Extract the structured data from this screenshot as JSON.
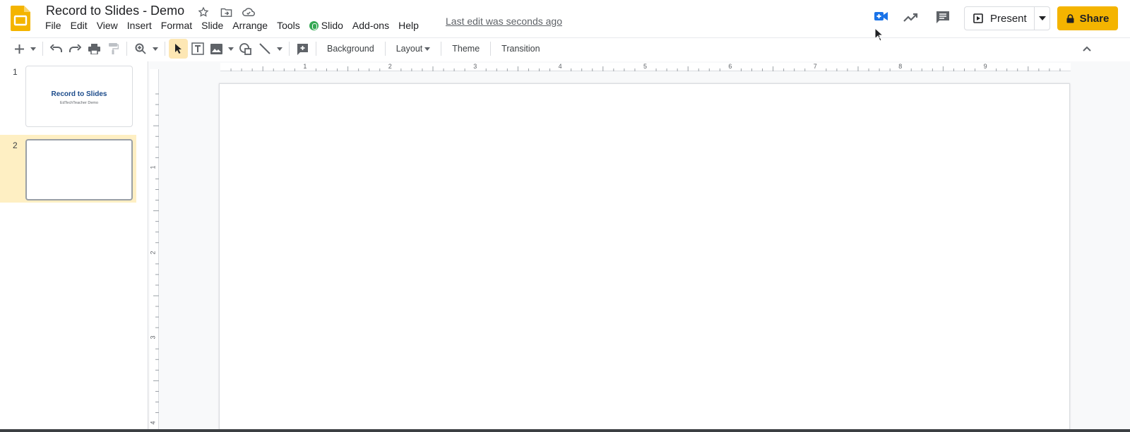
{
  "app": {
    "title": "Record to Slides - Demo",
    "last_edit": "Last edit was seconds ago",
    "accent_color": "#f4b400"
  },
  "menu": [
    "File",
    "Edit",
    "View",
    "Insert",
    "Format",
    "Slide",
    "Arrange",
    "Tools",
    "Slido",
    "Add-ons",
    "Help"
  ],
  "header_actions": {
    "present_label": "Present",
    "share_label": "Share"
  },
  "toolbar": {
    "background_label": "Background",
    "layout_label": "Layout",
    "theme_label": "Theme",
    "transition_label": "Transition"
  },
  "rulers": {
    "horizontal": [
      "1",
      "2",
      "3",
      "4",
      "5",
      "6",
      "7",
      "8",
      "9"
    ],
    "vertical": [
      "1",
      "2",
      "3",
      "4"
    ]
  },
  "slides": [
    {
      "number": "1",
      "title": "Record to Slides",
      "subtitle": "EdTechTeacher Demo"
    },
    {
      "number": "2",
      "title": "",
      "subtitle": ""
    }
  ]
}
